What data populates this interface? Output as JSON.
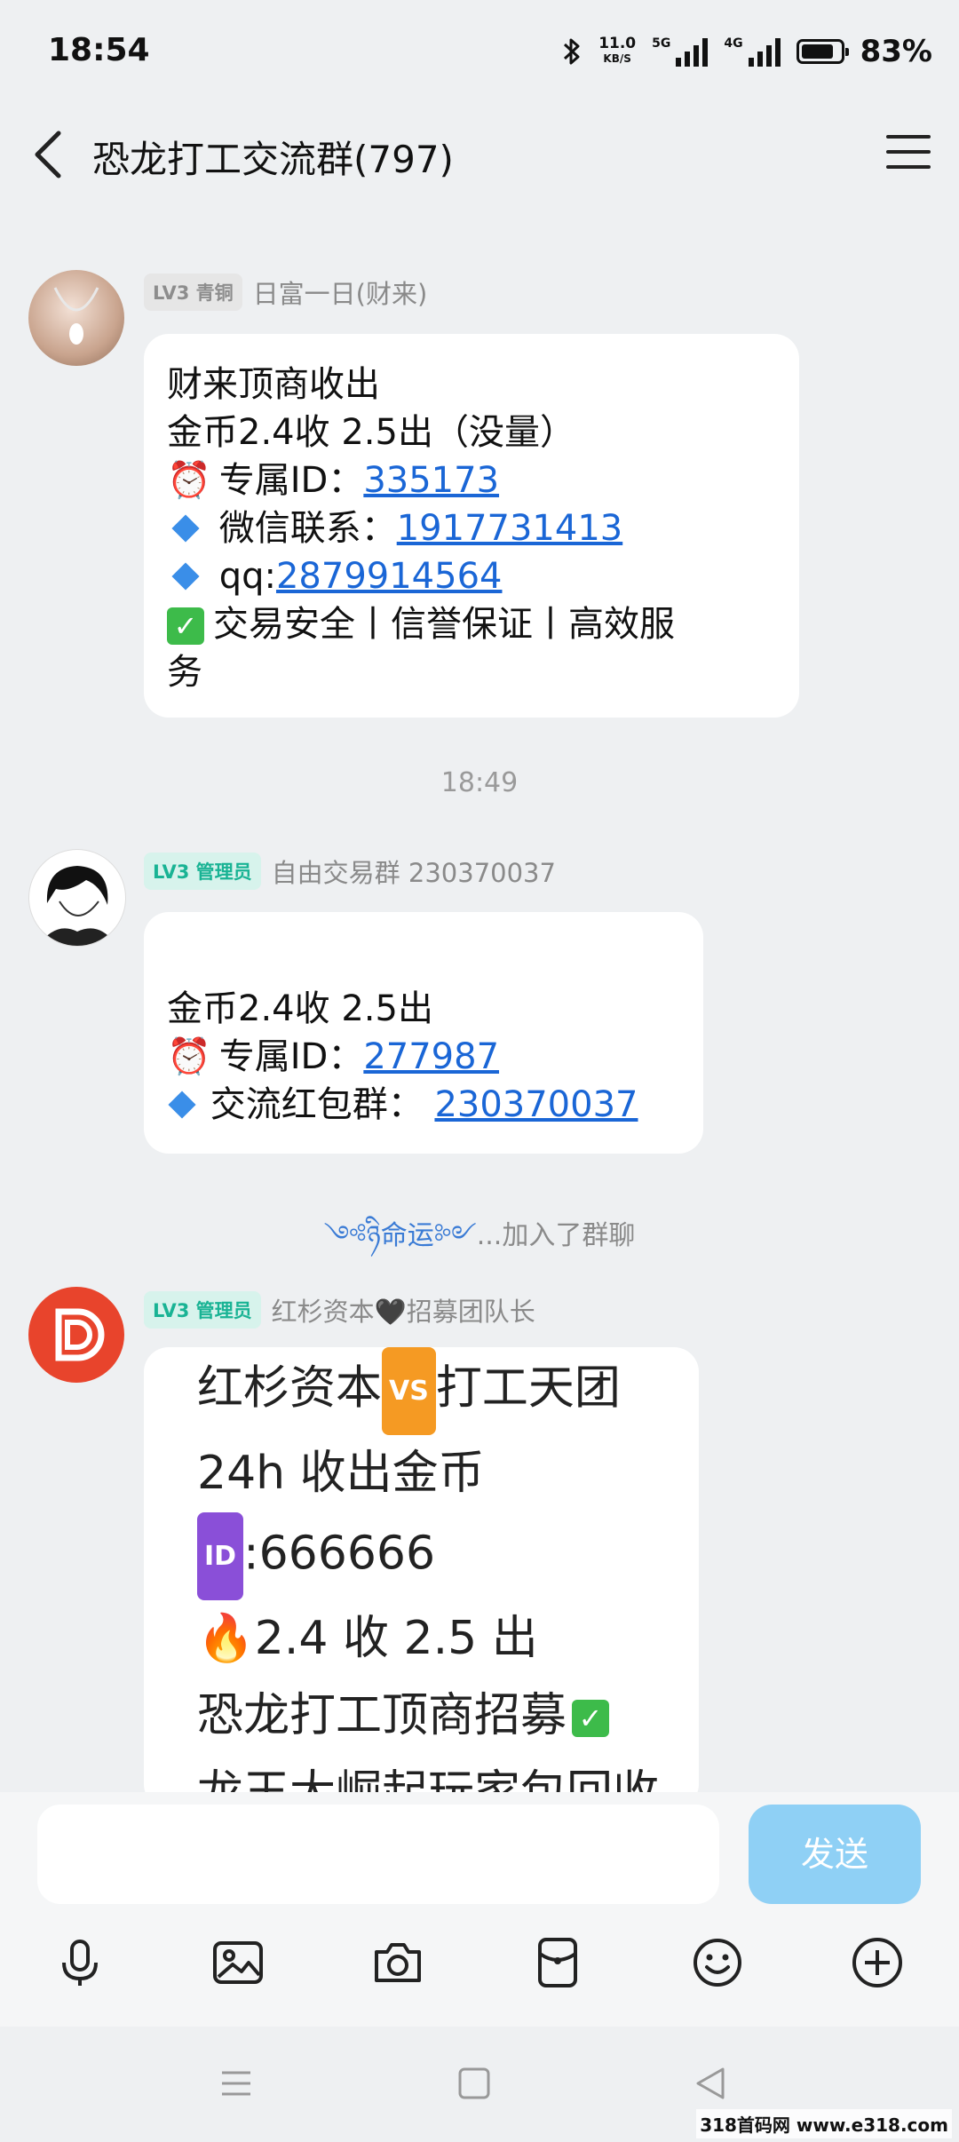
{
  "status_bar": {
    "time": "18:54",
    "net_speed_value": "11.0",
    "net_speed_unit": "KB/S",
    "sig1_label": "5G",
    "sig2_label": "4G",
    "battery": "83%",
    "battery_level": 0.83
  },
  "header": {
    "title": "恐龙打工交流群(797)"
  },
  "messages": [
    {
      "badge": "LV3 青铜",
      "sender": "日富一日(财来)",
      "lines": {
        "l1": "财来顶商收出",
        "l2": "金币2.4收   2.5出（没量）",
        "l3_prefix": "专属ID：",
        "l3_link": "335173",
        "l4_prefix": "微信联系：",
        "l4_link": "1917731413",
        "l5_prefix": " qq:",
        "l5_link": "2879914564",
        "l6": "交易安全丨信誉保证丨高效服",
        "l7": "务"
      }
    },
    {
      "badge": "LV3 管理员",
      "sender": "自由交易群 230370037",
      "lines": {
        "l1": "金币2.4收     2.5出",
        "l2_prefix": "专属ID：",
        "l2_link": "277987",
        "l3_prefix": "交流红包群：  ",
        "l3_link": "230370037"
      }
    },
    {
      "badge": "LV3 管理员",
      "sender": "红杉资本🖤招募团队长",
      "lines": {
        "l1a": "红杉资本",
        "l1_tag": "VS",
        "l1b": "打工天团",
        "l2": "24h 收出金币",
        "l3_tag": "ID",
        "l3": ":666666",
        "l4": "🔥2.4 收 2.5 出",
        "l5": "恐龙打工顶商招募",
        "l6": "龙王大崛起玩家包回收"
      }
    }
  ],
  "time_divider": "18:49",
  "system_message": {
    "nickname": "༺ཉི命运༻",
    "text": "...加入了群聊"
  },
  "input": {
    "placeholder": "",
    "send_label": "发送"
  },
  "watermark": "318首码网 www.e318.com"
}
